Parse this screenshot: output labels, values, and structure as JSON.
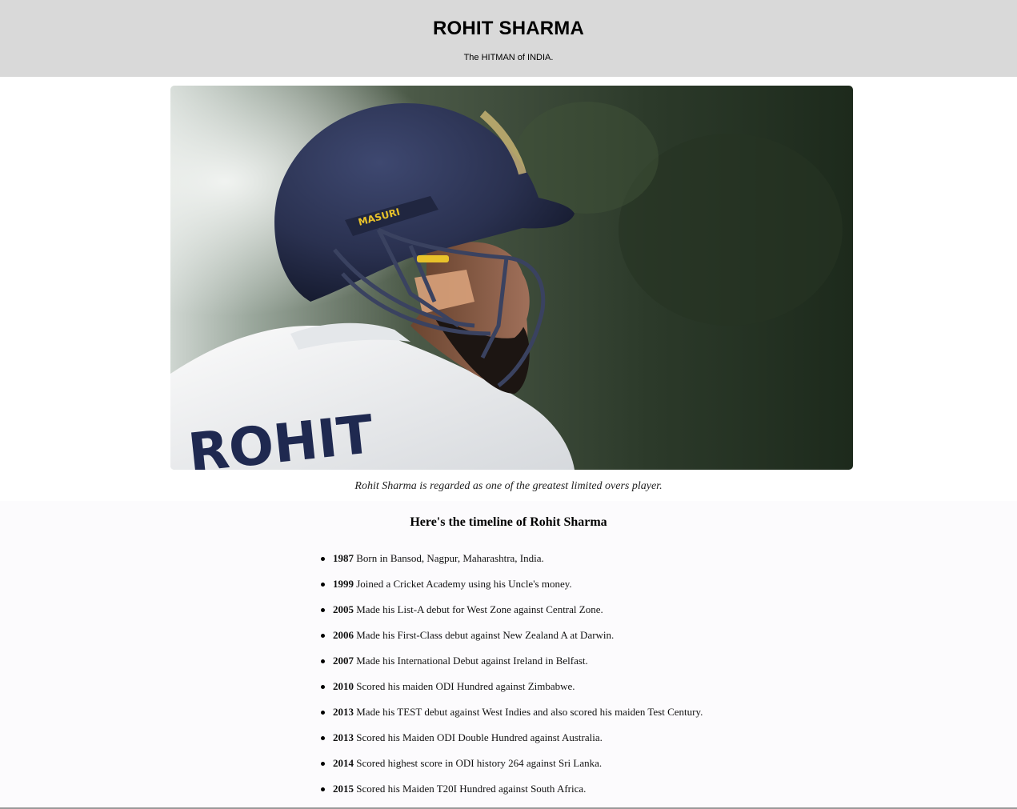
{
  "header": {
    "title": "ROHIT SHARMA",
    "tagline": "The HITMAN of INDIA."
  },
  "photo": {
    "helmet_brand": "MASURI",
    "shirt_text": "ROHIT"
  },
  "caption": "Rohit Sharma is regarded as one of the greatest limited overs player.",
  "timeline": {
    "heading": "Here's the timeline of Rohit Sharma",
    "items": [
      {
        "year": "1987",
        "text": "Born in Bansod, Nagpur, Maharashtra, India."
      },
      {
        "year": "1999",
        "text": "Joined a Cricket Academy using his Uncle's money."
      },
      {
        "year": "2005",
        "text": "Made his List-A debut for West Zone against Central Zone."
      },
      {
        "year": "2006",
        "text": "Made his First-Class debut against New Zealand A at Darwin."
      },
      {
        "year": "2007",
        "text": "Made his International Debut against Ireland in Belfast."
      },
      {
        "year": "2010",
        "text": "Scored his maiden ODI Hundred against Zimbabwe."
      },
      {
        "year": "2013",
        "text": "Made his TEST debut against West Indies and also scored his maiden Test Century."
      },
      {
        "year": "2013",
        "text": "Scored his Maiden ODI Double Hundred against Australia."
      },
      {
        "year": "2014",
        "text": "Scored highest score in ODI history 264 against Sri Lanka."
      },
      {
        "year": "2015",
        "text": "Scored his Maiden T20I Hundred against South Africa."
      }
    ]
  },
  "colors": {
    "header_bg": "#d9d9d9",
    "timeline_bg": "#fcfbfd",
    "helmet": "#2c3350",
    "brand_gold": "#e8c22a"
  }
}
